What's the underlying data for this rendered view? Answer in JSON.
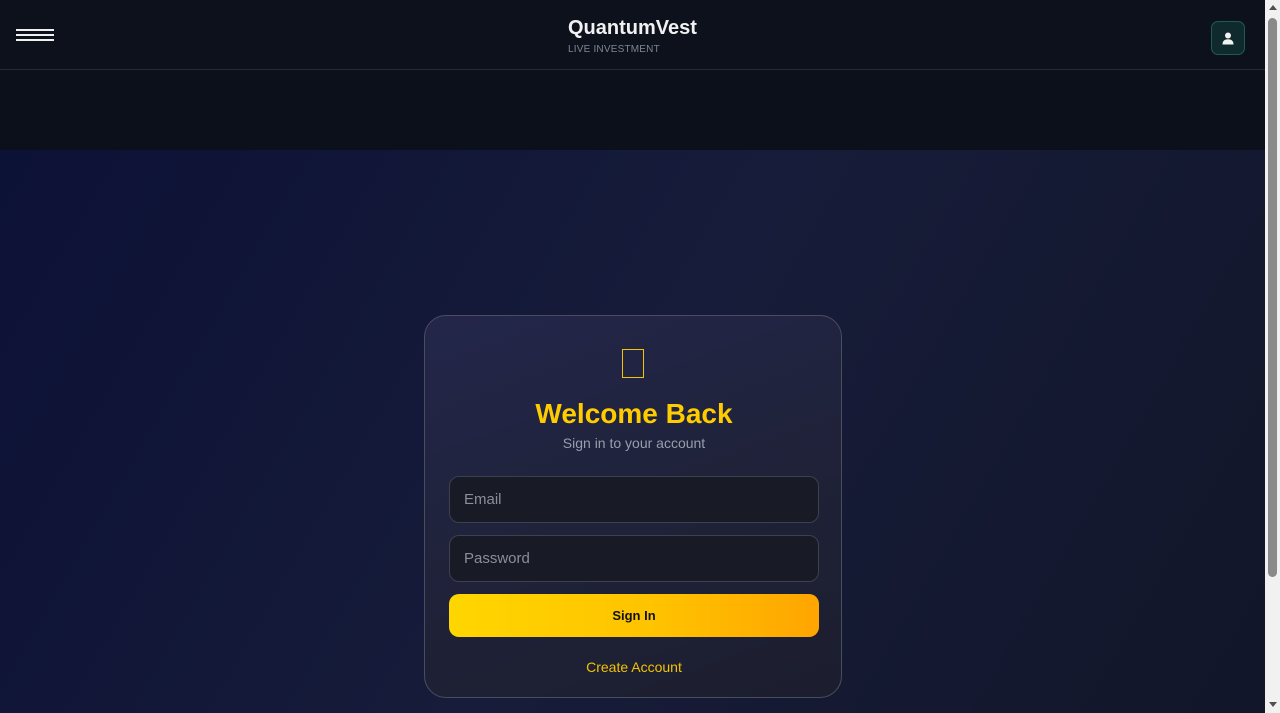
{
  "header": {
    "brand_title": "QuantumVest",
    "brand_subtitle": "LIVE INVESTMENT",
    "menu_icon": "hamburger-icon",
    "user_icon": "user-icon"
  },
  "login": {
    "icon": "lock-icon",
    "title": "Welcome Back",
    "subtitle": "Sign in to your account",
    "email_placeholder": "Email",
    "email_value": "",
    "password_placeholder": "Password",
    "password_value": "",
    "submit_label": "Sign In",
    "create_account_label": "Create Account"
  },
  "colors": {
    "accent": "#ffcc00",
    "accent_gradient_end": "#ffa500",
    "user_button_bg": "#0e2a2c"
  }
}
